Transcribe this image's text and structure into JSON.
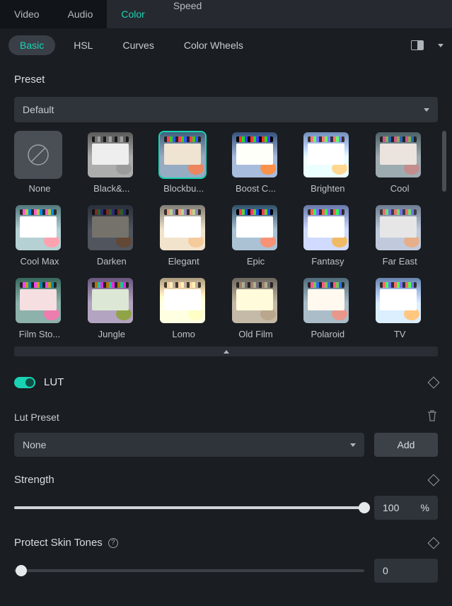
{
  "top_tabs": {
    "video": "Video",
    "audio": "Audio",
    "color": "Color",
    "speed": "Speed"
  },
  "sub_tabs": {
    "basic": "Basic",
    "hsl": "HSL",
    "curves": "Curves",
    "color_wheels": "Color Wheels"
  },
  "preset": {
    "heading": "Preset",
    "dropdown": "Default",
    "items": [
      {
        "label": "None",
        "tint": "none"
      },
      {
        "label": "Black&...",
        "tint": "bw"
      },
      {
        "label": "Blockbu...",
        "tint": "blockbuster",
        "selected": true
      },
      {
        "label": "Boost C...",
        "tint": "boost"
      },
      {
        "label": "Brighten",
        "tint": "brighten"
      },
      {
        "label": "Cool",
        "tint": "cool"
      },
      {
        "label": "Cool Max",
        "tint": "coolmax"
      },
      {
        "label": "Darken",
        "tint": "darken"
      },
      {
        "label": "Elegant",
        "tint": "elegant"
      },
      {
        "label": "Epic",
        "tint": "epic"
      },
      {
        "label": "Fantasy",
        "tint": "fantasy"
      },
      {
        "label": "Far East",
        "tint": "fareast"
      },
      {
        "label": "Film Sto...",
        "tint": "filmstock"
      },
      {
        "label": "Jungle",
        "tint": "jungle"
      },
      {
        "label": "Lomo",
        "tint": "lomo"
      },
      {
        "label": "Old Film",
        "tint": "oldfilm"
      },
      {
        "label": "Polaroid",
        "tint": "polaroid"
      },
      {
        "label": "TV",
        "tint": "tv"
      }
    ]
  },
  "lut": {
    "label": "LUT",
    "enabled": true,
    "preset_label": "Lut Preset",
    "preset_value": "None",
    "add": "Add"
  },
  "strength": {
    "label": "Strength",
    "value": "100",
    "unit": "%",
    "pct": 100
  },
  "skin": {
    "label": "Protect Skin Tones",
    "value": "0",
    "pct": 0
  }
}
